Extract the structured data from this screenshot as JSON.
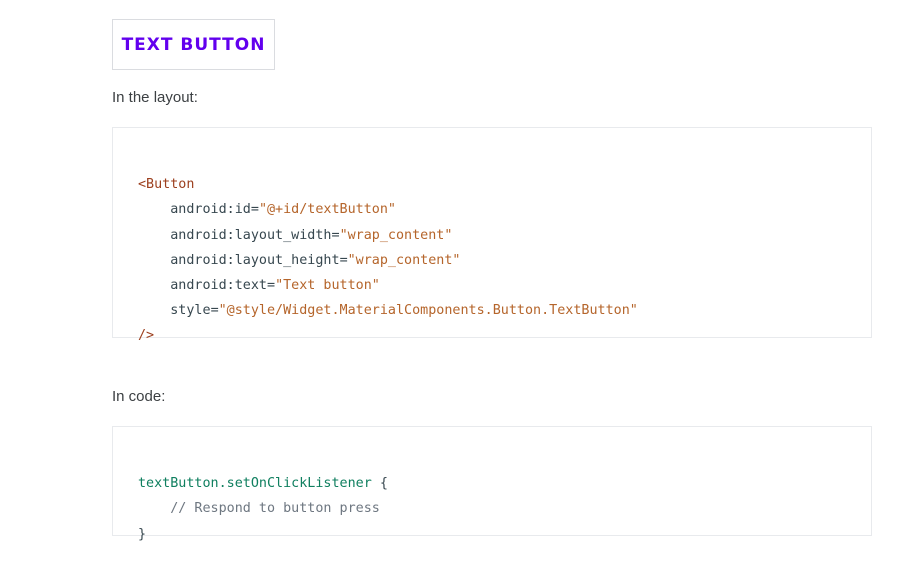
{
  "demo": {
    "button_label": "TEXT BUTTON"
  },
  "sections": {
    "layout_label": "In the layout:",
    "code_label": "In code:"
  },
  "xml": {
    "open_tag": "<Button",
    "attrs": [
      {
        "indent": "    ",
        "name": "android:id",
        "value": "\"@+id/textButton\""
      },
      {
        "indent": "    ",
        "name": "android:layout_width",
        "value": "\"wrap_content\""
      },
      {
        "indent": "    ",
        "name": "android:layout_height",
        "value": "\"wrap_content\""
      },
      {
        "indent": "    ",
        "name": "android:text",
        "value": "\"Text button\""
      },
      {
        "indent": "    ",
        "name": "style",
        "value": "\"@style/Widget.MaterialComponents.Button.TextButton\""
      }
    ],
    "close_tag": "/>"
  },
  "kotlin": {
    "call": "textButton.setOnClickListener",
    "open_brace": " {",
    "comment": "    // Respond to button press",
    "close_brace": "}"
  },
  "colors": {
    "button_text": "#6200ee",
    "xml_tag": "#9c3f1e",
    "string_value": "#b5652b",
    "function_call": "#0f7f5f",
    "comment": "#6e7781"
  }
}
